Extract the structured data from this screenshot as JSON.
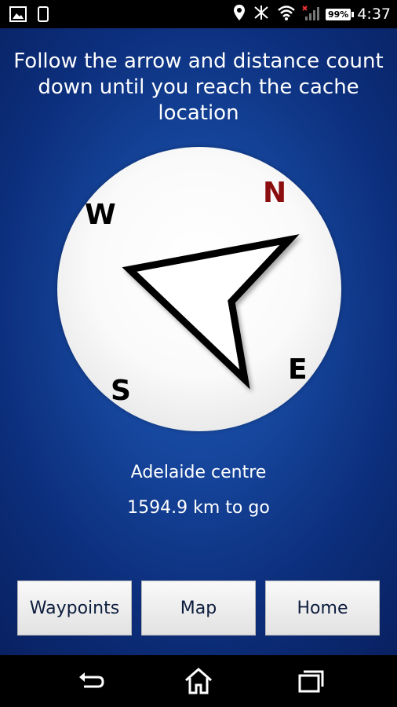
{
  "status_bar": {
    "time": "4:37",
    "battery": "99%",
    "left_icons": [
      "image-icon",
      "phone-icon"
    ],
    "right_icons": [
      "location-icon",
      "mute-icon",
      "wifi-icon",
      "signal-icon",
      "battery-icon"
    ]
  },
  "main": {
    "instruction": "Follow the arrow and distance count down until you reach the cache location",
    "compass": {
      "north": "N",
      "west": "W",
      "east": "E",
      "south": "S",
      "north_color": "#8b0d0d"
    },
    "destination": "Adelaide centre",
    "distance": "1594.9 km to go"
  },
  "buttons": {
    "waypoints": "Waypoints",
    "map": "Map",
    "home": "Home"
  },
  "navbar": {
    "icons": [
      "back-icon",
      "home-icon",
      "recents-icon"
    ]
  },
  "colors": {
    "background_center": "#1f5ab9",
    "background_edge": "#081f5e"
  }
}
